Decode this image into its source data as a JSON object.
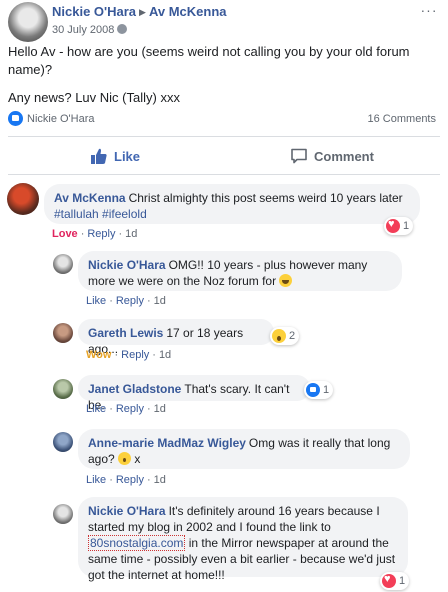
{
  "post": {
    "author": "Nickie O'Hara",
    "recipient": "Av McKenna",
    "date": "30 July 2008",
    "paragraph1": "Hello Av - how are you (seems weird not calling you by your old forum name)?",
    "paragraph2": "Any news? Luv Nic (Tally) xxx",
    "reactor_name": "Nickie O'Hara",
    "comments_count": "16 Comments",
    "like_label": "Like",
    "comment_label": "Comment"
  },
  "comments": [
    {
      "author": "Av McKenna",
      "text": "Christ almighty this post seems weird 10 years later",
      "hashtags": "#tallulah #ifeelold",
      "reaction_word": "Love",
      "reply_label": "Reply",
      "time": "1d",
      "reaction_count": "1",
      "reaction_icon": "love"
    },
    {
      "author": "Nickie O'Hara",
      "text": "OMG!! 10 years - plus however many more we were on the Noz forum for",
      "like_label": "Like",
      "reply_label": "Reply",
      "time": "1d",
      "emoji": "laughing"
    },
    {
      "author": "Gareth Lewis",
      "text": "17 or 18 years ago...",
      "reaction_word": "Wow",
      "reply_label": "Reply",
      "time": "1d",
      "reaction_count": "2",
      "reaction_icon": "wow"
    },
    {
      "author": "Janet Gladstone",
      "text": "That's scary. It can't be.",
      "like_label": "Like",
      "reply_label": "Reply",
      "time": "1d",
      "reaction_count": "1",
      "reaction_icon": "like"
    },
    {
      "author": "Anne-marie MadMaz Wigley",
      "text_a": "Omg was it really that long ago?",
      "text_b": "x",
      "like_label": "Like",
      "reply_label": "Reply",
      "time": "1d",
      "emoji": "wow"
    },
    {
      "author": "Nickie O'Hara",
      "text_a": "It's definitely around 16 years because I started my blog in 2002 and I found the link to",
      "link": "80snostalgia.com",
      "text_b": "in the Mirror newspaper at around the same time - possibly even a bit earlier - because we'd just got the internet at home!!!",
      "reaction_count": "1",
      "reaction_icon": "love"
    }
  ],
  "colors": {
    "link": "#385898",
    "love": "#e0245e",
    "wow": "#e7a327",
    "like_blue": "#4267b2",
    "bubble": "#f2f3f5"
  }
}
